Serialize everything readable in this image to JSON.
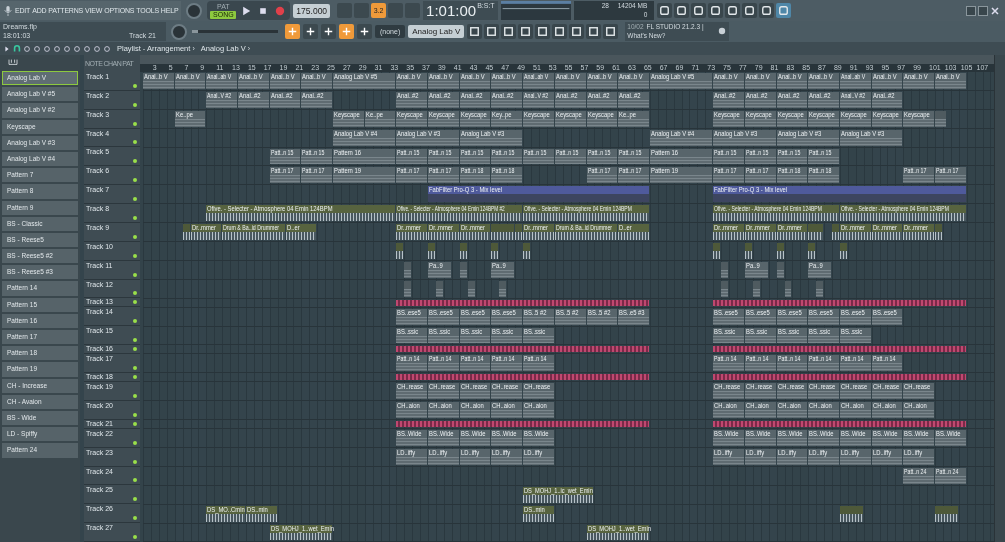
{
  "menu": [
    "EDIT",
    "ADD",
    "PATTERNS",
    "VIEW",
    "OPTIONS",
    "TOOLS",
    "HELP"
  ],
  "transport": {
    "pat_label": "PAT",
    "song_label": "SONG",
    "song_mode": true,
    "tempo": "175.000",
    "time": "1:01:00",
    "time_unit": "B:S:T",
    "cpu": "28",
    "memory": "14204 MB",
    "voices": "0"
  },
  "project": {
    "file": "Dreams.flp",
    "elapsed": "18:01:03",
    "track": "Track 21"
  },
  "toolbar_toggles": [
    {
      "selected": false
    },
    {
      "selected": false
    },
    {
      "selected": true,
      "label": "3.2"
    },
    {
      "selected": false
    },
    {
      "selected": false
    }
  ],
  "snap": {
    "value": "(none)"
  },
  "channel": {
    "value": "Analog Lab V"
  },
  "news": {
    "date": "10/02",
    "title": "FL STUDIO 21.2.3 |",
    "link": "What's New?"
  },
  "playlist": {
    "title": "Playlist - Arrangement",
    "separator": "›",
    "pattern": "Analog Lab V",
    "end": "›"
  },
  "header_tabs": [
    "NOTE",
    "CHAN",
    "PAT"
  ],
  "patterns": [
    {
      "label": "Analog Lab V",
      "selected": true
    },
    {
      "label": "Analog Lab V #5",
      "selected": false
    },
    {
      "label": "Analog Lab V #2",
      "selected": false
    },
    {
      "label": "Keyscape",
      "selected": false
    },
    {
      "label": "Analog Lab V #3",
      "selected": false
    },
    {
      "label": "Analog Lab V #4",
      "selected": false
    },
    {
      "label": "Pattern 7",
      "selected": false
    },
    {
      "label": "Pattern 8",
      "selected": false
    },
    {
      "label": "Pattern 9",
      "selected": false
    },
    {
      "label": "BS - Classic",
      "selected": false
    },
    {
      "label": "BS - Reese5",
      "selected": false
    },
    {
      "label": "BS - Reese5 #2",
      "selected": false
    },
    {
      "label": "BS - Reese5 #3",
      "selected": false
    },
    {
      "label": "Pattern 14",
      "selected": false
    },
    {
      "label": "Pattern 15",
      "selected": false
    },
    {
      "label": "Pattern 16",
      "selected": false
    },
    {
      "label": "Pattern 17",
      "selected": false
    },
    {
      "label": "Pattern 18",
      "selected": false
    },
    {
      "label": "Pattern 19",
      "selected": false
    },
    {
      "label": "CH - Increase",
      "selected": false
    },
    {
      "label": "CH - Avaion",
      "selected": false
    },
    {
      "label": "BS - Wide",
      "selected": false
    },
    {
      "label": "LD - Spiffy",
      "selected": false
    },
    {
      "label": "Pattern 24",
      "selected": false
    }
  ],
  "ruler": [
    "3",
    "5",
    "7",
    "9",
    "11",
    "13",
    "15",
    "17",
    "19",
    "21",
    "23",
    "25",
    "27",
    "29",
    "31",
    "33",
    "35",
    "37",
    "39",
    "41",
    "43",
    "45",
    "47",
    "49",
    "51",
    "53",
    "55",
    "57",
    "59",
    "61",
    "63",
    "65",
    "67",
    "69",
    "71",
    "73",
    "75",
    "77",
    "79",
    "81",
    "83",
    "85",
    "87",
    "89",
    "91",
    "93",
    "95",
    "97",
    "99",
    "101",
    "103",
    "105",
    "107"
  ],
  "tracks": [
    {
      "name": "Track 1",
      "kind": "pattern",
      "clips": [
        {
          "label": "Anal..b V"
        },
        {
          "label": "Anal..b V"
        },
        {
          "label": "Anal..ab V"
        },
        {
          "label": "Anal..b V"
        },
        {
          "label": "Anal..b V"
        },
        {
          "label": "Anal..b V"
        },
        {
          "label": "Analog Lab V #5"
        },
        {
          "label": "Anal..b V"
        },
        {
          "label": "Anal..b V"
        },
        {
          "label": "Anal..b V"
        },
        {
          "label": "Anal..b V"
        },
        {
          "label": "Anal..ab V"
        },
        {
          "label": "Anal..b V"
        },
        {
          "label": "Anal..b V"
        },
        {
          "label": "Anal..b V"
        },
        {
          "label": "Analog Lab V #5"
        },
        {
          "label": "Anal..b V"
        },
        {
          "label": "Anal..b V"
        },
        {
          "label": "Anal..b V"
        },
        {
          "label": "Anal..b V"
        },
        {
          "label": "Anal..ab V"
        },
        {
          "label": "Anal..b V"
        },
        {
          "label": "Anal..b V"
        },
        {
          "label": "Anal..b V"
        }
      ]
    },
    {
      "name": "Track 2",
      "kind": "pattern",
      "clips": [
        {
          "label": "Anal..V #2"
        },
        {
          "label": "Anal..#2"
        },
        {
          "label": "Anal..#2"
        },
        {
          "label": "Anal..#2"
        },
        {
          "label": "Anal..#2"
        },
        {
          "label": "Anal..#2"
        },
        {
          "label": "Anal..#2"
        },
        {
          "label": "Anal..#2"
        },
        {
          "label": "Anal..V #2"
        },
        {
          "label": "Anal..#2"
        },
        {
          "label": "Anal..#2"
        },
        {
          "label": "Anal..#2"
        },
        {
          "label": "Anal..#2"
        },
        {
          "label": "Anal..#2"
        },
        {
          "label": "Anal..#2"
        },
        {
          "label": "Anal..#2"
        },
        {
          "label": "Anal..V #2"
        },
        {
          "label": "Anal..#2"
        }
      ]
    },
    {
      "name": "Track 3",
      "kind": "pattern",
      "clips": [
        {
          "label": "Ke..pe"
        },
        {
          "label": "Keyscape"
        },
        {
          "label": "Ke..pe"
        },
        {
          "label": "Keyscape"
        },
        {
          "label": "Keyscape"
        },
        {
          "label": "Keyscape"
        },
        {
          "label": "Key..pe"
        },
        {
          "label": "Keyscape"
        },
        {
          "label": "Keyscape"
        },
        {
          "label": "Keyscape"
        },
        {
          "label": "Ke..pe"
        },
        {
          "label": "Keyscape"
        },
        {
          "label": "Keyscape"
        },
        {
          "label": "Keyscape"
        },
        {
          "label": "Keyscape"
        },
        {
          "label": "Keyscape"
        },
        {
          "label": "Keyscape"
        },
        {
          "label": "Keyscape"
        },
        {
          "kind": "blank"
        }
      ]
    },
    {
      "name": "Track 4",
      "kind": "pattern",
      "clips": [
        {
          "label": "Analog Lab V #4"
        },
        {
          "label": "Analog Lab V #3"
        },
        {
          "label": "Analog Lab V #3"
        },
        {
          "label": "Analog Lab V #4"
        },
        {
          "label": "Analog Lab V #3"
        },
        {
          "label": "Analog Lab V #3"
        },
        {
          "label": "Analog Lab V #3"
        }
      ]
    },
    {
      "name": "Track 5",
      "kind": "pattern",
      "clips": [
        {
          "label": "Patt..n 15"
        },
        {
          "label": "Patt..n 15"
        },
        {
          "label": "Pattern 16"
        },
        {
          "label": "Patt..n 15"
        },
        {
          "label": "Patt..n 15"
        },
        {
          "label": "Patt..n 15"
        },
        {
          "label": "Patt..n 15"
        },
        {
          "label": "Patt..n 15"
        },
        {
          "label": "Patt..n 15"
        },
        {
          "label": "Patt..n 15"
        },
        {
          "label": "Patt..n 15"
        },
        {
          "label": "Pattern 16"
        },
        {
          "label": "Patt..n 15"
        },
        {
          "label": "Patt..n 15"
        },
        {
          "label": "Patt..n 15"
        },
        {
          "label": "Patt..n 15"
        }
      ]
    },
    {
      "name": "Track 6",
      "kind": "pattern",
      "clips": [
        {
          "label": "Patt..n 17"
        },
        {
          "label": "Patt..n 17"
        },
        {
          "label": "Pattern 19"
        },
        {
          "label": "Patt..n 17"
        },
        {
          "label": "Patt..n 17"
        },
        {
          "label": "Patt..n 18"
        },
        {
          "label": "Patt..n 18"
        },
        {
          "label": "Patt..n 17"
        },
        {
          "label": "Patt..n 17"
        },
        {
          "label": "Pattern 19"
        },
        {
          "label": "Patt..n 17"
        },
        {
          "label": "Patt..n 17"
        },
        {
          "label": "Patt..n 18"
        },
        {
          "label": "Patt..n 18"
        },
        {
          "label": "Patt..n 17"
        },
        {
          "label": "Patt..n 17"
        }
      ]
    },
    {
      "name": "Track 7",
      "kind": "automation",
      "clips": [
        {
          "label": "FabFilter Pro-Q 3 - Mix level"
        },
        {
          "label": "FabFilter Pro-Q 3 - Mix level"
        }
      ]
    },
    {
      "name": "Track 8",
      "kind": "audio",
      "clips": [
        {
          "label": "Ofive. - Selecter - Atmosphere 04 Emin 124BPM"
        },
        {
          "label": "Ofive. - Selecter - Atmosphere 04 Emin 124BPM #2"
        },
        {
          "label": "Ofive. - Selecter - Atmosphere 04 Emin 124BPM"
        },
        {
          "label": "Ofive. - Selecter - Atmosphere 04 Emin 124BPM"
        },
        {
          "label": "Ofive. - Selecter - Atmosphere 04 Emin 124BPM"
        }
      ]
    },
    {
      "name": "Track 9",
      "kind": "audio",
      "clips": [
        {
          "kind": "blank"
        },
        {
          "label": "Dr..mmer"
        },
        {
          "label": "Drum & Ba..id Drummer"
        },
        {
          "label": "D..er"
        },
        {
          "label": "Dr..mmer"
        },
        {
          "label": "Dr..mmer"
        },
        {
          "label": "Dr..mmer"
        },
        {
          "kind": "blank"
        },
        {
          "kind": "blank"
        },
        {
          "label": "Dr..mmer"
        },
        {
          "label": "Drum & Ba..id Drummer"
        },
        {
          "label": "D..er"
        },
        {
          "label": "Dr..mmer"
        },
        {
          "label": "Dr..mmer"
        },
        {
          "label": "Dr..mmer"
        },
        {
          "kind": "blank"
        },
        {
          "kind": "blank"
        },
        {
          "label": "Dr..mmer"
        },
        {
          "label": "Dr..mmer"
        },
        {
          "label": "Dr..mmer"
        },
        {
          "kind": "blank"
        }
      ]
    },
    {
      "name": "Track 10",
      "kind": "audio",
      "clips": [
        {
          "kind": "blank"
        },
        {
          "kind": "blank"
        },
        {
          "kind": "blank"
        },
        {
          "kind": "blank"
        },
        {
          "kind": "blank"
        },
        {
          "kind": "blank"
        },
        {
          "kind": "blank"
        },
        {
          "kind": "blank"
        },
        {
          "kind": "blank"
        },
        {
          "kind": "blank"
        }
      ]
    },
    {
      "name": "Track 11",
      "kind": "pattern",
      "clips": [
        {
          "kind": "blank"
        },
        {
          "label": "Pa..9"
        },
        {
          "kind": "blank"
        },
        {
          "label": "Pa..9"
        },
        {
          "kind": "blank"
        },
        {
          "label": "Pa..9"
        },
        {
          "kind": "blank"
        },
        {
          "label": "Pa..9"
        }
      ]
    },
    {
      "name": "Track 12",
      "kind": "pattern",
      "clips": [
        {
          "kind": "blank"
        },
        {
          "kind": "blank"
        },
        {
          "kind": "blank"
        },
        {
          "kind": "blank"
        },
        {
          "kind": "blank"
        },
        {
          "kind": "blank"
        },
        {
          "kind": "blank"
        },
        {
          "kind": "blank"
        }
      ]
    },
    {
      "name": "Track 13",
      "kind": "block",
      "clips": [
        {
          "kind": "blank"
        },
        {
          "kind": "blank"
        }
      ]
    },
    {
      "name": "Track 14",
      "kind": "pattern",
      "clips": [
        {
          "label": "BS..ese5"
        },
        {
          "label": "BS..ese5"
        },
        {
          "label": "BS..ese5"
        },
        {
          "label": "BS..ese5"
        },
        {
          "label": "BS..5 #2"
        },
        {
          "label": "BS..5 #2"
        },
        {
          "label": "BS..5 #2"
        },
        {
          "label": "BS..e5 #3"
        },
        {
          "label": "BS..ese5"
        },
        {
          "label": "BS..ese5"
        },
        {
          "label": "BS..ese5"
        },
        {
          "label": "BS..ese5"
        },
        {
          "label": "BS..ese5"
        },
        {
          "label": "BS..ese5"
        }
      ]
    },
    {
      "name": "Track 15",
      "kind": "pattern",
      "clips": [
        {
          "label": "BS..ssic"
        },
        {
          "label": "BS..ssic"
        },
        {
          "label": "BS..ssic"
        },
        {
          "label": "BS..ssic"
        },
        {
          "label": "BS..ssic"
        },
        {
          "label": "BS..ssic"
        },
        {
          "label": "BS..ssic"
        },
        {
          "label": "BS..ssic"
        },
        {
          "label": "BS..ssic"
        },
        {
          "label": "BS..ssic"
        }
      ]
    },
    {
      "name": "Track 16",
      "kind": "block",
      "clips": [
        {
          "kind": "blank"
        },
        {
          "kind": "blank"
        }
      ]
    },
    {
      "name": "Track 17",
      "kind": "pattern",
      "clips": [
        {
          "label": "Patt..n 14"
        },
        {
          "label": "Patt..n 14"
        },
        {
          "label": "Patt..n 14"
        },
        {
          "label": "Patt..n 14"
        },
        {
          "label": "Patt..n 14"
        },
        {
          "label": "Patt..n 14"
        },
        {
          "label": "Patt..n 14"
        },
        {
          "label": "Patt..n 14"
        },
        {
          "label": "Patt..n 14"
        },
        {
          "label": "Patt..n 14"
        },
        {
          "label": "Patt..n 14"
        }
      ]
    },
    {
      "name": "Track 18",
      "kind": "block",
      "clips": [
        {
          "kind": "blank"
        },
        {
          "kind": "blank"
        }
      ]
    },
    {
      "name": "Track 19",
      "kind": "pattern",
      "clips": [
        {
          "label": "CH..rease"
        },
        {
          "label": "CH..rease"
        },
        {
          "label": "CH..rease"
        },
        {
          "label": "CH..rease"
        },
        {
          "label": "CH..rease"
        },
        {
          "label": "CH..rease"
        },
        {
          "label": "CH..rease"
        },
        {
          "label": "CH..rease"
        },
        {
          "label": "CH..rease"
        },
        {
          "label": "CH..rease"
        },
        {
          "label": "CH..rease"
        },
        {
          "label": "CH..rease"
        }
      ]
    },
    {
      "name": "Track 20",
      "kind": "pattern",
      "clips": [
        {
          "label": "CH..aion"
        },
        {
          "label": "CH..aion"
        },
        {
          "label": "CH..aion"
        },
        {
          "label": "CH..aion"
        },
        {
          "label": "CH..aion"
        },
        {
          "label": "CH..aion"
        },
        {
          "label": "CH..aion"
        },
        {
          "label": "CH..aion"
        },
        {
          "label": "CH..aion"
        },
        {
          "label": "CH..aion"
        },
        {
          "label": "CH..aion"
        },
        {
          "label": "CH..aion"
        }
      ]
    },
    {
      "name": "Track 21",
      "kind": "block",
      "clips": [
        {
          "kind": "blank"
        },
        {
          "kind": "blank"
        }
      ]
    },
    {
      "name": "Track 22",
      "kind": "pattern",
      "clips": [
        {
          "label": "BS..Wide"
        },
        {
          "label": "BS..Wide"
        },
        {
          "label": "BS..Wide"
        },
        {
          "label": "BS..Wide"
        },
        {
          "label": "BS..Wide"
        },
        {
          "label": "BS..Wide"
        },
        {
          "label": "BS..Wide"
        },
        {
          "label": "BS..Wide"
        },
        {
          "label": "BS..Wide"
        },
        {
          "label": "BS..Wide"
        },
        {
          "label": "BS..Wide"
        },
        {
          "label": "BS..Wide"
        },
        {
          "label": "BS..Wide"
        }
      ]
    },
    {
      "name": "Track 23",
      "kind": "pattern",
      "clips": [
        {
          "label": "LD..iffy"
        },
        {
          "label": "LD..iffy"
        },
        {
          "label": "LD..iffy"
        },
        {
          "label": "LD..iffy"
        },
        {
          "label": "LD..iffy"
        },
        {
          "label": "LD..iffy"
        },
        {
          "label": "LD..iffy"
        },
        {
          "label": "LD..iffy"
        },
        {
          "label": "LD..iffy"
        },
        {
          "label": "LD..iffy"
        },
        {
          "label": "LD..iffy"
        },
        {
          "label": "LD..iffy"
        }
      ]
    },
    {
      "name": "Track 24",
      "kind": "pattern",
      "clips": [
        {
          "label": "Patt..n 24"
        },
        {
          "label": "Patt..n 24"
        }
      ]
    },
    {
      "name": "Track 25",
      "kind": "audio",
      "clips": [
        {
          "label": "DS_MOHJ_1..ic_wet_Emin"
        }
      ]
    },
    {
      "name": "Track 26",
      "kind": "audio",
      "clips": [
        {
          "label": "DS_MO..Cmin"
        },
        {
          "label": "DS..min"
        },
        {
          "label": "DS..min"
        },
        {
          "kind": "blank"
        },
        {
          "kind": "blank"
        }
      ]
    },
    {
      "name": "Track 27",
      "kind": "audio",
      "clips": [
        {
          "label": "DS_MOHJ_1..wet_Emin"
        },
        {
          "label": "DS_MOHJ_1..wet_Emin"
        }
      ]
    }
  ]
}
